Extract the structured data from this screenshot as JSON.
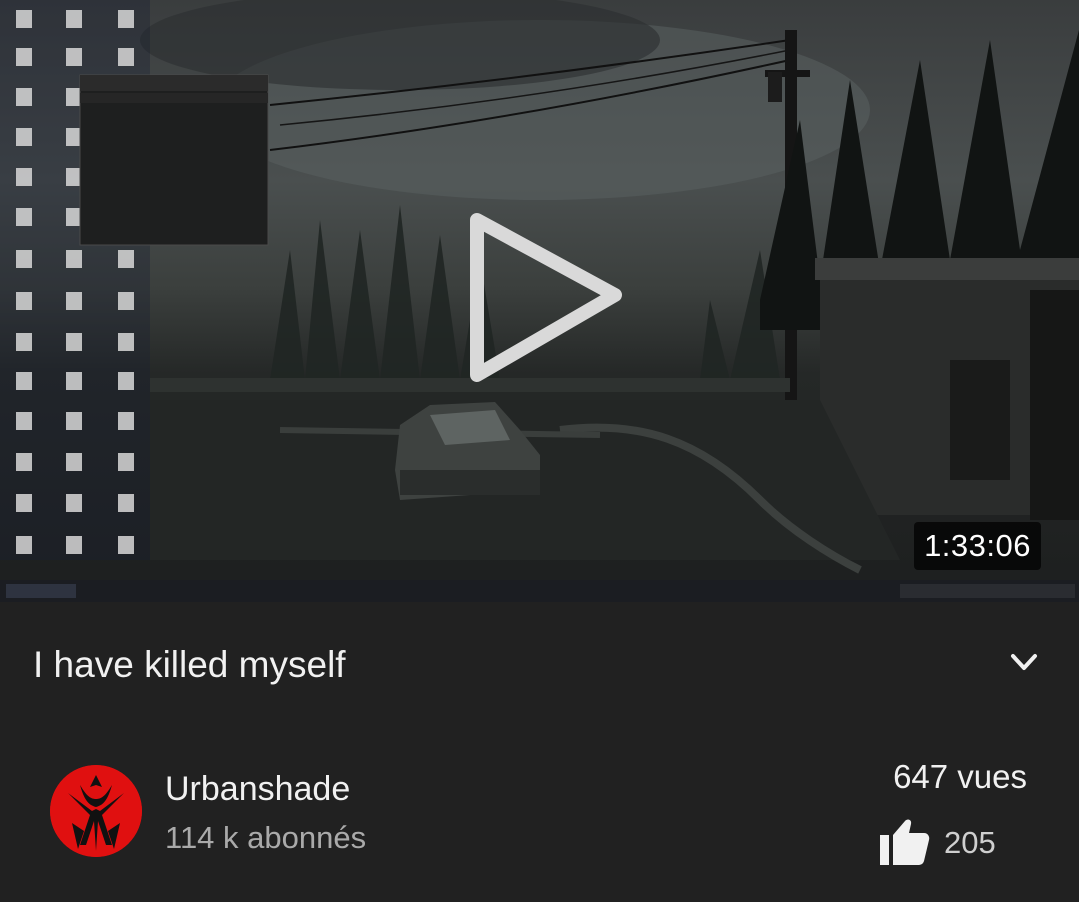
{
  "player": {
    "duration": "1:33:06"
  },
  "video": {
    "title": "I have killed myself"
  },
  "channel": {
    "name": "Urbanshade",
    "subscribers": "114 k abonnés"
  },
  "stats": {
    "views": "647 vues",
    "likes": "205"
  },
  "icons": {
    "play": "play-icon",
    "expand": "chevron-down-icon",
    "like": "thumbs-up-icon"
  },
  "colors": {
    "background": "#212121",
    "text_primary": "#f1f1f1",
    "text_secondary": "#aaaaaa",
    "avatar": "#e01010"
  }
}
